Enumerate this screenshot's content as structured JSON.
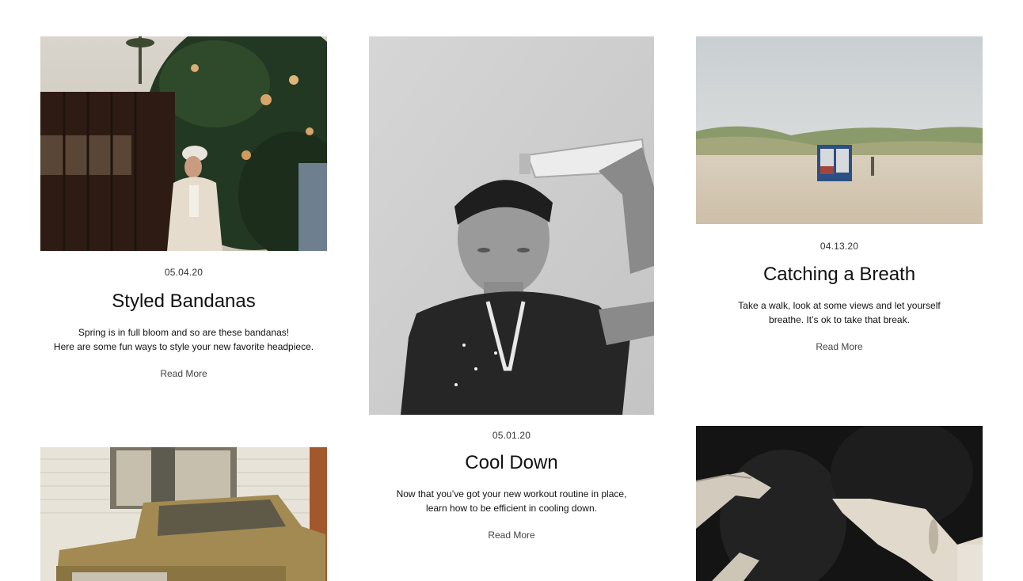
{
  "posts": [
    {
      "date": "05.04.20",
      "title": "Styled Bandanas",
      "excerpt": "Spring is in full bloom and so are these bandanas!\nHere are some fun ways to style your new favorite headpiece.",
      "read_more": "Read More"
    },
    {
      "date": "05.01.20",
      "title": "Cool Down",
      "excerpt": "Now that you’ve got your new workout routine in place,\nlearn how to be efficient in cooling down.",
      "read_more": "Read More"
    },
    {
      "date": "04.13.20",
      "title": "Catching a Breath",
      "excerpt": "Take a walk, look at some views and let yourself\nbreathe. It’s ok to take that break.",
      "read_more": "Read More"
    }
  ]
}
